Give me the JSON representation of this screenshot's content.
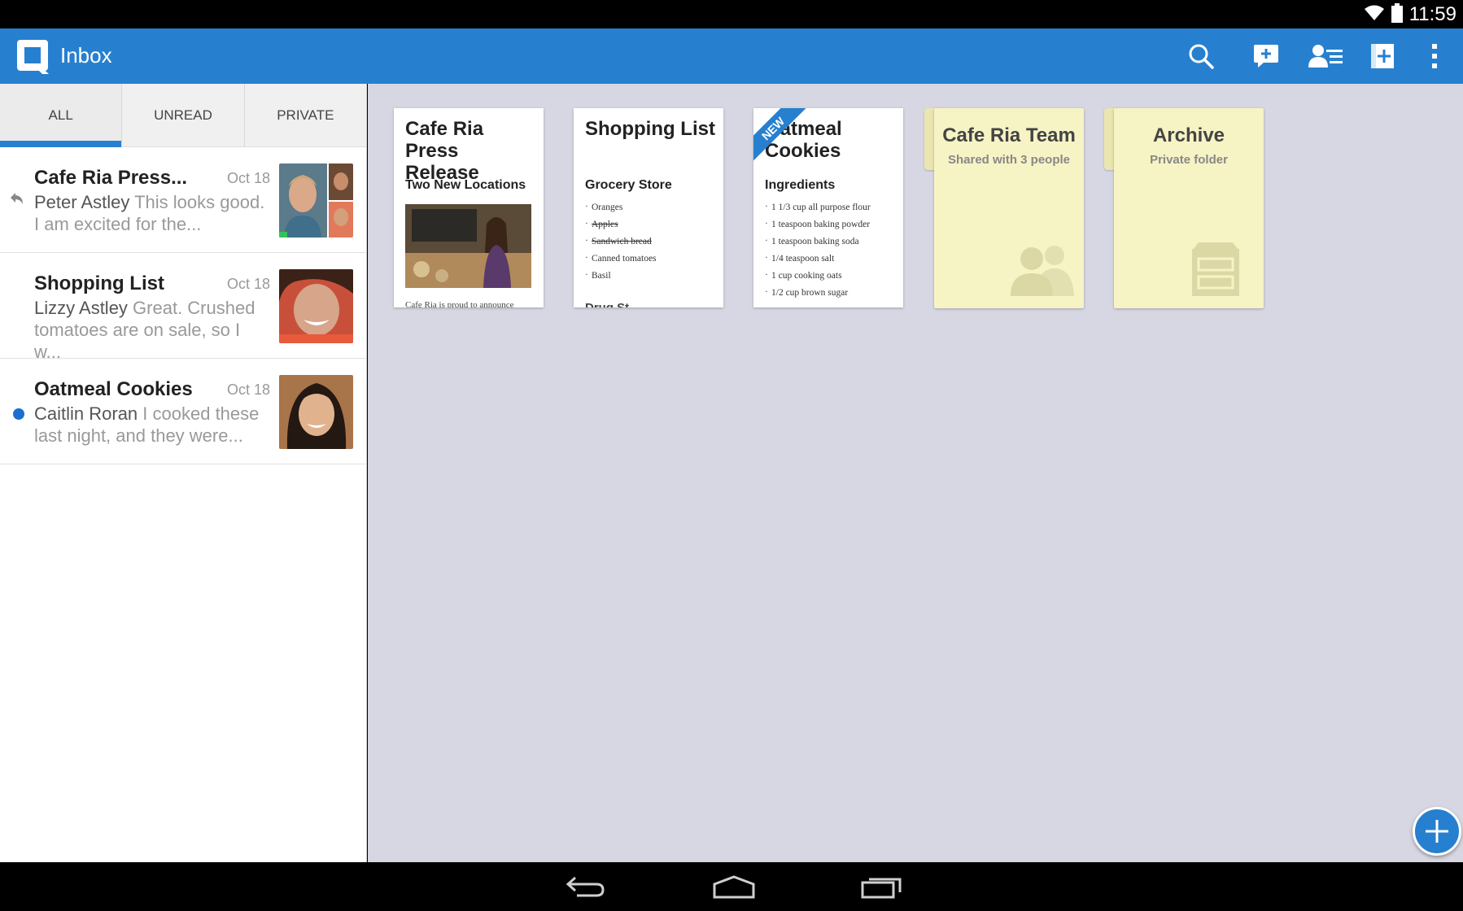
{
  "status_bar": {
    "time": "11:59"
  },
  "action_bar": {
    "title": "Inbox",
    "actions": [
      "search-icon",
      "new-message-icon",
      "contacts-icon",
      "new-document-icon",
      "overflow-menu-icon"
    ]
  },
  "tabs": [
    {
      "label": "ALL",
      "active": true
    },
    {
      "label": "UNREAD",
      "active": false
    },
    {
      "label": "PRIVATE",
      "active": false
    }
  ],
  "conversations": [
    {
      "title": "Cafe Ria Press...",
      "date": "Oct 18",
      "sender": "Peter Astley",
      "snippet": " This looks good. I am excited for the...",
      "indicator": "reply"
    },
    {
      "title": "Shopping List",
      "date": "Oct 18",
      "sender": "Lizzy Astley",
      "snippet": " Great. Crushed tomatoes are on sale, so I w...",
      "indicator": "none"
    },
    {
      "title": "Oatmeal Cookies",
      "date": "Oct 18",
      "sender": "Caitlin Roran",
      "snippet": " I cooked these last night, and they were...",
      "indicator": "unread"
    }
  ],
  "documents": [
    {
      "title": "Cafe Ria Press Release",
      "subtitle": "Two New Locations",
      "footer": "Cafe Ria is proud to announce"
    },
    {
      "title": "Shopping List",
      "subtitle": "Grocery Store",
      "items": [
        "Oranges",
        "Apples",
        "Sandwich bread",
        "Canned tomatoes",
        "Basil"
      ],
      "done": [
        false,
        true,
        true,
        false,
        false
      ],
      "footer": "Drug St..."
    },
    {
      "title": "Oatmeal Cookies",
      "badge": "NEW",
      "subtitle": "Ingredients",
      "items": [
        "1 1/3 cup all purpose flour",
        "1 teaspoon baking powder",
        "1 teaspoon baking soda",
        "1/4 teaspoon salt",
        "1 cup cooking oats",
        "1/2 cup brown sugar"
      ]
    }
  ],
  "folders": [
    {
      "name": "Cafe Ria Team",
      "subtitle": "Shared with 3 people",
      "icon": "people-icon"
    },
    {
      "name": "Archive",
      "subtitle": "Private folder",
      "icon": "archive-icon"
    }
  ],
  "colors": {
    "accent": "#2780cf",
    "main_background": "#d7d7e3",
    "folder": "#f6f3c5",
    "unread_dot": "#1c6fd0"
  }
}
